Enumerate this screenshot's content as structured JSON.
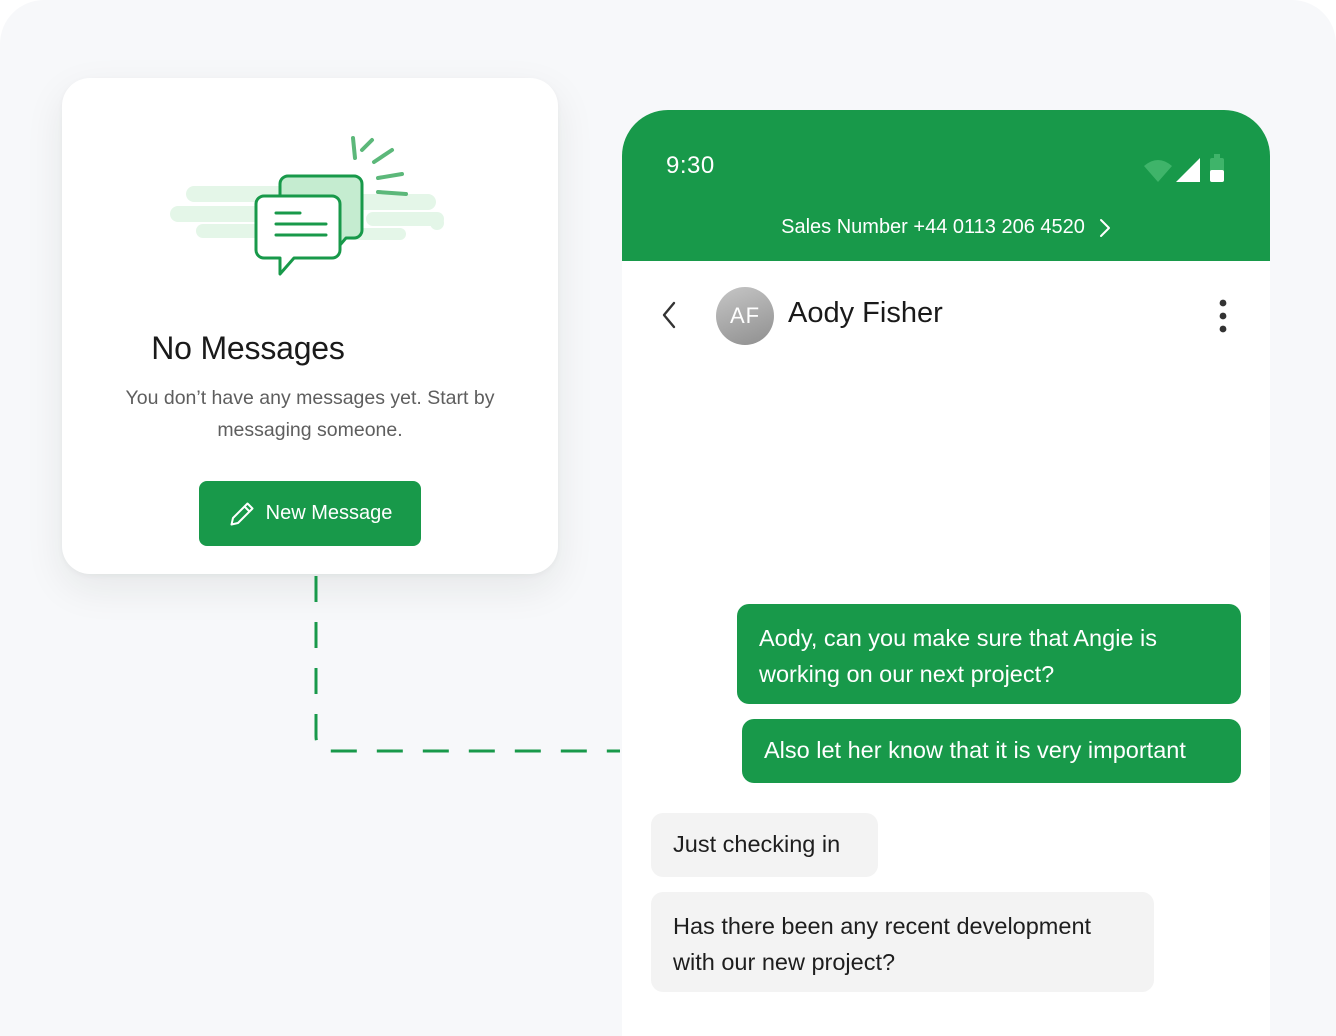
{
  "empty_state": {
    "illustration_icon": "chat-bubbles-icon",
    "title": "No Messages",
    "description": "You don’t have any messages yet. Start by messaging someone.",
    "button_label": "New Message",
    "button_icon": "pencil-icon"
  },
  "phone": {
    "status_bar": {
      "time": "9:30",
      "icons": [
        "wifi-icon",
        "cellular-signal-icon",
        "battery-icon"
      ]
    },
    "sales_number": "Sales Number +44 0113 206 4520",
    "header": {
      "avatar_initials": "AF",
      "contact_name": "Aody Fisher"
    },
    "messages": [
      {
        "direction": "outgoing",
        "text": "Aody, can you make sure that Angie is working on our next project?"
      },
      {
        "direction": "outgoing",
        "text": "Also let her know that it is very important"
      },
      {
        "direction": "incoming",
        "text": "Just checking in"
      },
      {
        "direction": "incoming",
        "text": "Has there been any recent development with our new project?"
      }
    ]
  },
  "colors": {
    "brand_green": "#18994a",
    "light_green": "#dff5e4",
    "page_background": "#f7f8fa",
    "incoming_bubble": "#f3f3f3"
  }
}
